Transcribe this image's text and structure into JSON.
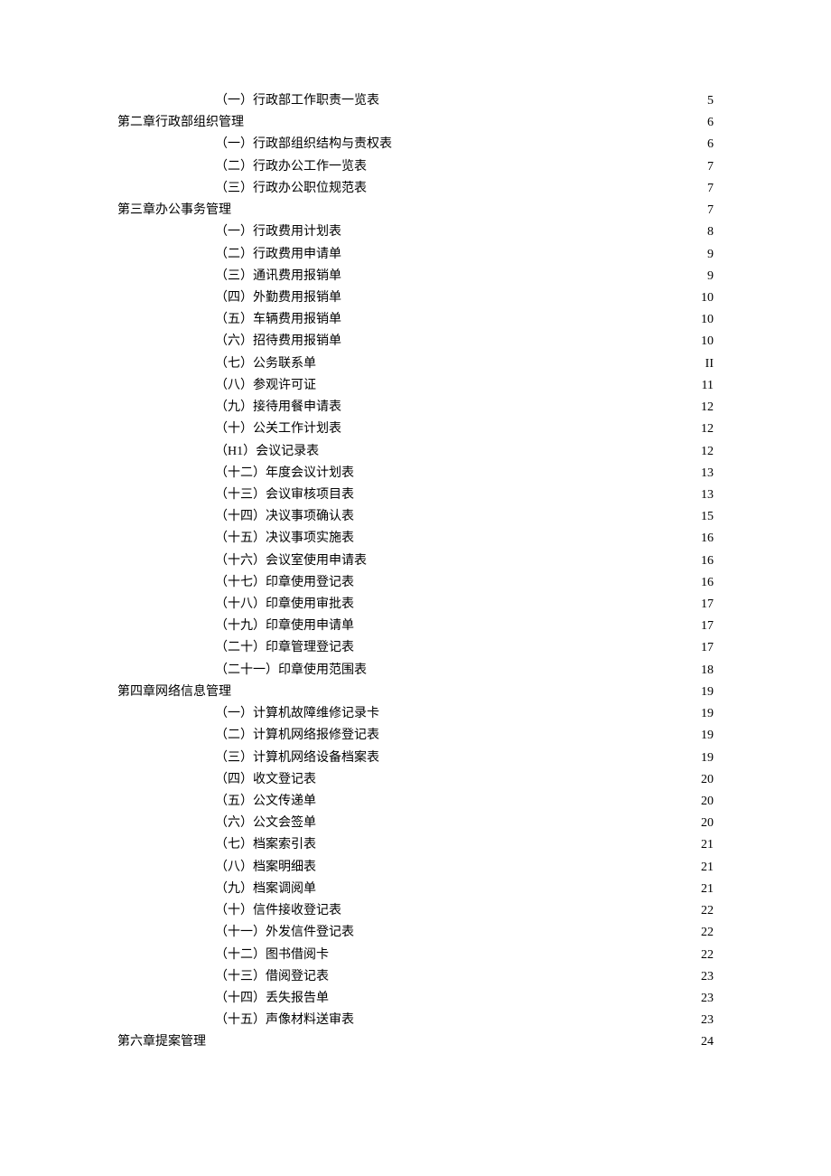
{
  "toc": [
    {
      "level": "sub",
      "title": "（一）行政部工作职责一览表",
      "page": "5"
    },
    {
      "level": "chapter",
      "title": "第二章行政部组织管理",
      "page": "6"
    },
    {
      "level": "sub",
      "title": "（一）行政部组织结构与责权表",
      "page": "6"
    },
    {
      "level": "sub",
      "title": "（二）行政办公工作一览表",
      "page": "7"
    },
    {
      "level": "sub",
      "title": "（三）行政办公职位规范表",
      "page": "7"
    },
    {
      "level": "chapter",
      "title": "第三章办公事务管理",
      "page": "7"
    },
    {
      "level": "sub",
      "title": "（一）行政费用计划表",
      "page": "8"
    },
    {
      "level": "sub",
      "title": "（二）行政费用申请单",
      "page": "9"
    },
    {
      "level": "sub",
      "title": "（三）通讯费用报销单",
      "page": "9"
    },
    {
      "level": "sub",
      "title": "（四）外勤费用报销单",
      "page": "10"
    },
    {
      "level": "sub",
      "title": "（五）车辆费用报销单",
      "page": "10"
    },
    {
      "level": "sub",
      "title": "（六）招待费用报销单",
      "page": "10"
    },
    {
      "level": "sub",
      "title": "（七）公务联系单",
      "page": "II"
    },
    {
      "level": "sub",
      "title": "（八）参观许可证",
      "page": "11"
    },
    {
      "level": "sub",
      "title": "（九）接待用餐申请表",
      "page": "12"
    },
    {
      "level": "sub",
      "title": "（十）公关工作计划表",
      "page": "12"
    },
    {
      "level": "sub",
      "title": "（H1）会议记录表",
      "page": "12"
    },
    {
      "level": "sub",
      "title": "（十二）年度会议计划表",
      "page": "13"
    },
    {
      "level": "sub",
      "title": "（十三）会议审核项目表",
      "page": "13"
    },
    {
      "level": "sub",
      "title": "（十四）决议事项确认表",
      "page": "15"
    },
    {
      "level": "sub",
      "title": "（十五）决议事项实施表",
      "page": "16"
    },
    {
      "level": "sub",
      "title": "（十六）会议室使用申请表",
      "page": "16"
    },
    {
      "level": "sub",
      "title": "（十七）印章使用登记表",
      "page": "16"
    },
    {
      "level": "sub",
      "title": "（十八）印章使用审批表",
      "page": "17"
    },
    {
      "level": "sub",
      "title": "（十九）印章使用申请单",
      "page": "17"
    },
    {
      "level": "sub",
      "title": "（二十）印章管理登记表",
      "page": "17"
    },
    {
      "level": "sub",
      "title": "（二十一）印章使用范围表",
      "page": "18"
    },
    {
      "level": "chapter",
      "title": "第四章网络信息管理",
      "page": "19"
    },
    {
      "level": "sub",
      "title": "（一）计算机故障维修记录卡",
      "page": "19"
    },
    {
      "level": "sub",
      "title": "（二）计算机网络报修登记表",
      "page": "19"
    },
    {
      "level": "sub",
      "title": "（三）计算机网络设备档案表",
      "page": "19"
    },
    {
      "level": "sub",
      "title": "（四）收文登记表",
      "page": "20"
    },
    {
      "level": "sub",
      "title": "（五）公文传递单",
      "page": "20"
    },
    {
      "level": "sub",
      "title": "（六）公文会签单",
      "page": "20"
    },
    {
      "level": "sub",
      "title": "（七）档案索引表",
      "page": "21"
    },
    {
      "level": "sub",
      "title": "（八）档案明细表",
      "page": "21"
    },
    {
      "level": "sub",
      "title": "（九）档案调阅单",
      "page": "21"
    },
    {
      "level": "sub",
      "title": "（十）信件接收登记表",
      "page": "22"
    },
    {
      "level": "sub",
      "title": "（十一）外发信件登记表",
      "page": "22"
    },
    {
      "level": "sub",
      "title": "（十二）图书借阅卡",
      "page": "22"
    },
    {
      "level": "sub",
      "title": "（十三）借阅登记表",
      "page": "23"
    },
    {
      "level": "sub",
      "title": "（十四）丢失报告单",
      "page": "23"
    },
    {
      "level": "sub",
      "title": "（十五）声像材料送审表",
      "page": "23"
    },
    {
      "level": "chapter",
      "title": "第六章提案管理",
      "page": "24"
    }
  ]
}
